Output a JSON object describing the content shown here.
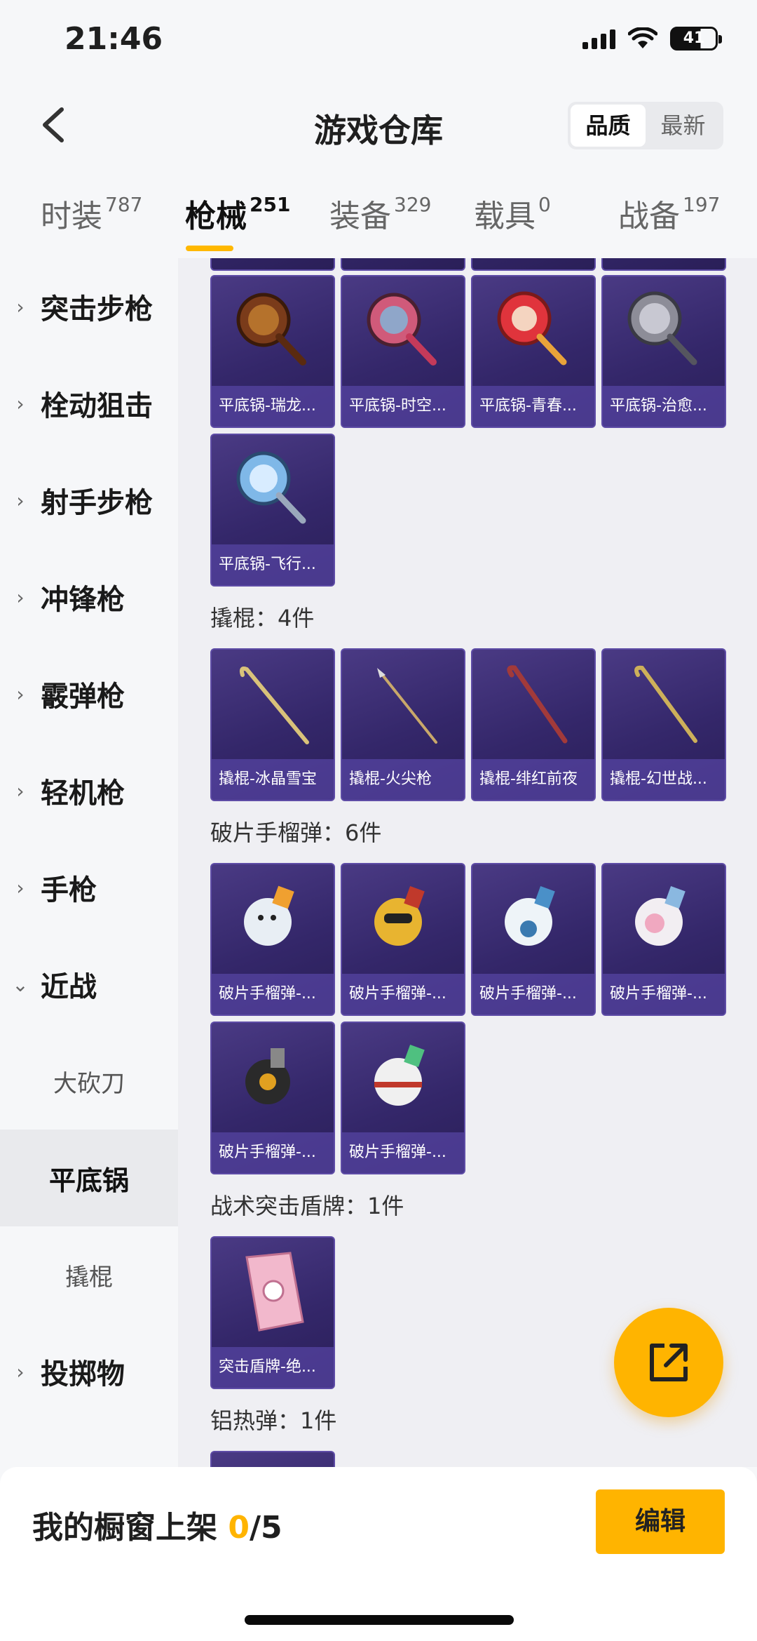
{
  "status": {
    "time": "21:46",
    "battery": "41"
  },
  "header": {
    "title": "游戏仓库",
    "sort": [
      "品质",
      "最新"
    ]
  },
  "tabs": [
    {
      "label": "时装",
      "count": "787"
    },
    {
      "label": "枪械",
      "count": "251"
    },
    {
      "label": "装备",
      "count": "329"
    },
    {
      "label": "载具",
      "count": "0"
    },
    {
      "label": "战备",
      "count": "197"
    }
  ],
  "sidebar": {
    "items": [
      "突击步枪",
      "栓动狙击",
      "射手步枪",
      "冲锋枪",
      "霰弹枪",
      "轻机枪",
      "手枪",
      "近战",
      "大砍刀",
      "平底锅",
      "撬棍",
      "投掷物"
    ]
  },
  "sections": {
    "crowbar": "撬棍：4件",
    "grenade": "破片手榴弹：6件",
    "shield": "战术突击盾牌：1件",
    "thermite": "铝热弹：1件"
  },
  "items": {
    "pan": [
      "平底锅-瑞龙...",
      "平底锅-时空...",
      "平底锅-青春...",
      "平底锅-治愈...",
      "平底锅-飞行..."
    ],
    "crowbar": [
      "撬棍-冰晶雪宝",
      "撬棍-火尖枪",
      "撬棍-绯红前夜",
      "撬棍-幻世战..."
    ],
    "grenade": [
      "破片手榴弹-...",
      "破片手榴弹-...",
      "破片手榴弹-...",
      "破片手榴弹-...",
      "破片手榴弹-...",
      "破片手榴弹-..."
    ],
    "shield": [
      "突击盾牌-绝..."
    ]
  },
  "bottom": {
    "showcase_label": "我的橱窗上架",
    "count": "0",
    "total": "/5",
    "edit_label": "编辑"
  },
  "colors": {
    "accent": "#ffb400",
    "card": "#34276a"
  }
}
